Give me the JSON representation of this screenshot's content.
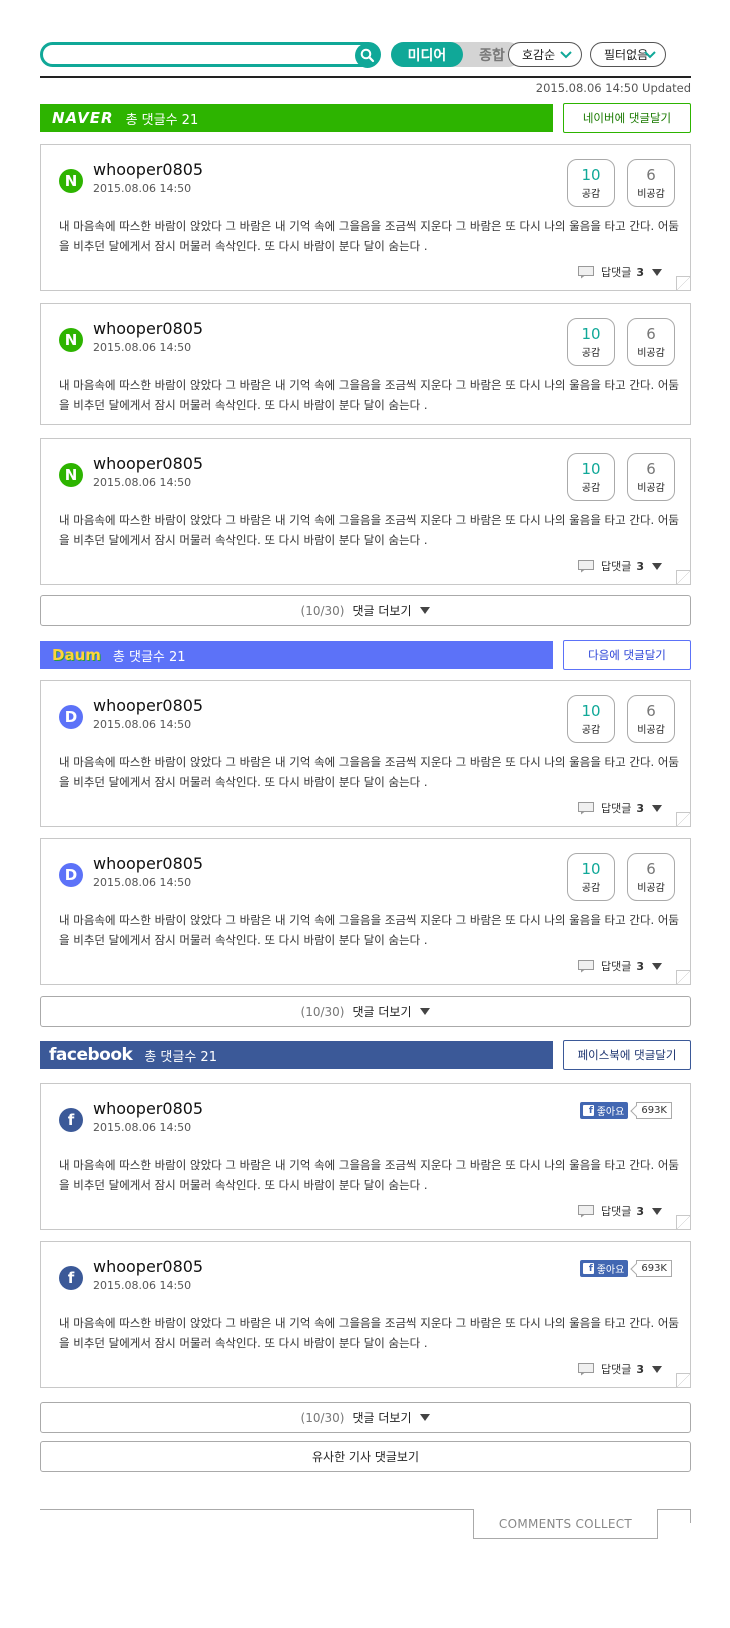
{
  "toolbar": {
    "search_value": "",
    "toggle_active": "미디어",
    "toggle_inactive": "종합",
    "sort_label": "호감순",
    "filter_label": "필터없음",
    "updated": "2015.08.06 14:50 Updated"
  },
  "colors": {
    "accent": "#10a898",
    "naver": "#2db400",
    "daum": "#5c72f8",
    "facebook": "#3b5998"
  },
  "sections": {
    "naver": {
      "brand": "NAVER",
      "total_label": "총 댓글수 21",
      "write_button": "네이버에 댓글달기",
      "more": {
        "page": "(10/30)",
        "label": "댓글 더보기"
      },
      "comments": [
        {
          "avatar": "N",
          "user": "whooper0805",
          "date": "2015.08.06 14:50",
          "text": "내 마음속에 따스한 바람이 앉았다 그 바람은 내 기억 속에 그을음을 조금씩 지운다 그 바람은 또 다시 나의 울음을 타고 간다. 어둠을 비추던 달에게서 잠시 머물러 속삭인다. 또 다시 바람이 분다 달이 숨는다 .",
          "likes": "10",
          "like_label": "공감",
          "dislikes": "6",
          "dislike_label": "비공감",
          "reply_label": "답댓글",
          "reply_count": "3"
        },
        {
          "avatar": "N",
          "user": "whooper0805",
          "date": "2015.08.06 14:50",
          "text": "내 마음속에 따스한 바람이 앉았다 그 바람은 내 기억 속에 그을음을 조금씩 지운다 그 바람은 또 다시 나의 울음을 타고 간다. 어둠을 비추던 달에게서 잠시 머물러 속삭인다. 또 다시 바람이 분다 달이 숨는다 .",
          "likes": "10",
          "like_label": "공감",
          "dislikes": "6",
          "dislike_label": "비공감"
        },
        {
          "avatar": "N",
          "user": "whooper0805",
          "date": "2015.08.06 14:50",
          "text": "내 마음속에 따스한 바람이 앉았다 그 바람은 내 기억 속에 그을음을 조금씩 지운다 그 바람은 또 다시 나의 울음을 타고 간다. 어둠을 비추던 달에게서 잠시 머물러 속삭인다. 또 다시 바람이 분다 달이 숨는다 .",
          "likes": "10",
          "like_label": "공감",
          "dislikes": "6",
          "dislike_label": "비공감",
          "reply_label": "답댓글",
          "reply_count": "3"
        }
      ]
    },
    "daum": {
      "brand": "Daum",
      "total_label": "총 댓글수 21",
      "write_button": "다음에 댓글달기",
      "more": {
        "page": "(10/30)",
        "label": "댓글 더보기"
      },
      "comments": [
        {
          "avatar": "D",
          "user": "whooper0805",
          "date": "2015.08.06 14:50",
          "text": "내 마음속에 따스한 바람이 앉았다 그 바람은 내 기억 속에 그을음을 조금씩 지운다 그 바람은 또 다시 나의 울음을 타고 간다. 어둠을 비추던 달에게서 잠시 머물러 속삭인다. 또 다시 바람이 분다 달이 숨는다 .",
          "likes": "10",
          "like_label": "공감",
          "dislikes": "6",
          "dislike_label": "비공감",
          "reply_label": "답댓글",
          "reply_count": "3"
        },
        {
          "avatar": "D",
          "user": "whooper0805",
          "date": "2015.08.06 14:50",
          "text": "내 마음속에 따스한 바람이 앉았다 그 바람은 내 기억 속에 그을음을 조금씩 지운다 그 바람은 또 다시 나의 울음을 타고 간다. 어둠을 비추던 달에게서 잠시 머물러 속삭인다. 또 다시 바람이 분다 달이 숨는다 .",
          "likes": "10",
          "like_label": "공감",
          "dislikes": "6",
          "dislike_label": "비공감",
          "reply_label": "답댓글",
          "reply_count": "3"
        }
      ]
    },
    "facebook": {
      "brand": "facebook",
      "total_label": "총 댓글수 21",
      "write_button": "페이스북에 댓글달기",
      "more": {
        "page": "(10/30)",
        "label": "댓글 더보기"
      },
      "comments": [
        {
          "avatar": "f",
          "user": "whooper0805",
          "date": "2015.08.06 14:50",
          "text": "내 마음속에 따스한 바람이 앉았다 그 바람은 내 기억 속에 그을음을 조금씩 지운다 그 바람은 또 다시 나의 울음을 타고 간다. 어둠을 비추던 달에게서 잠시 머물러 속삭인다. 또 다시 바람이 분다 달이 숨는다 .",
          "like_button": "좋아요",
          "like_count": "693K",
          "reply_label": "답댓글",
          "reply_count": "3"
        },
        {
          "avatar": "f",
          "user": "whooper0805",
          "date": "2015.08.06 14:50",
          "text": "내 마음속에 따스한 바람이 앉았다 그 바람은 내 기억 속에 그을음을 조금씩 지운다 그 바람은 또 다시 나의 울음을 타고 간다. 어둠을 비추던 달에게서 잠시 머물러 속삭인다. 또 다시 바람이 분다 달이 숨는다 .",
          "like_button": "좋아요",
          "like_count": "693K",
          "reply_label": "답댓글",
          "reply_count": "3"
        }
      ]
    }
  },
  "similar_button": "유사한 기사 댓글보기",
  "footer": "COMMENTS COLLECT"
}
